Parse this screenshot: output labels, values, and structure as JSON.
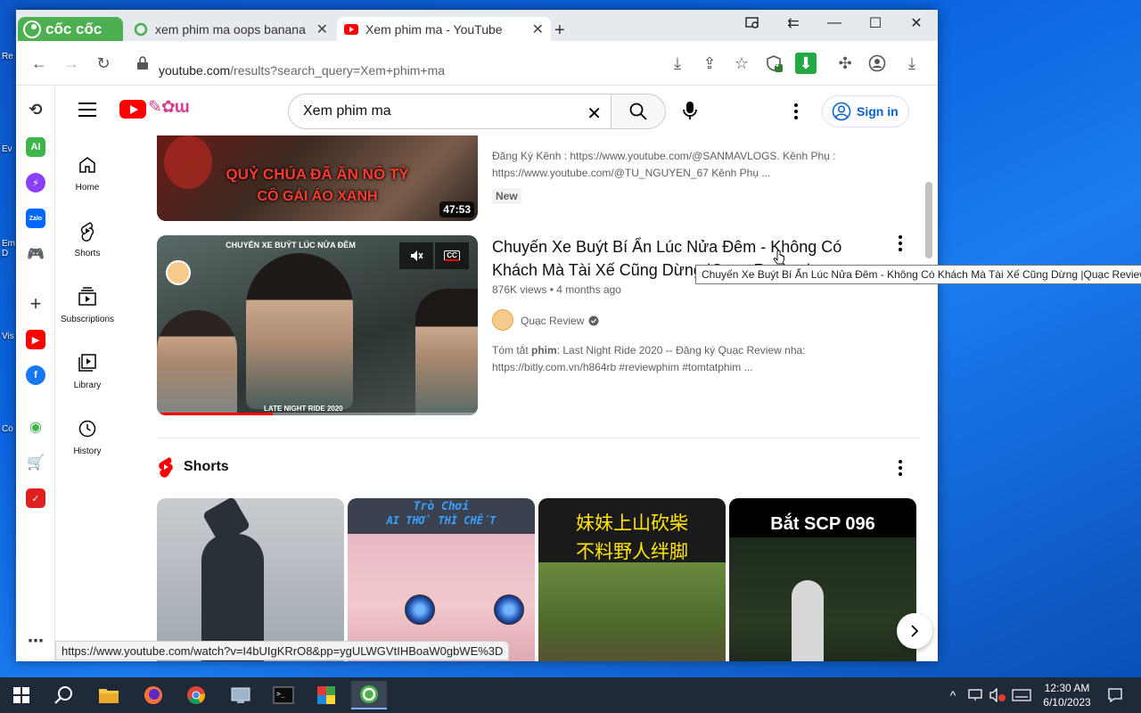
{
  "browser": {
    "brand": "cốc cốc",
    "tabs": [
      {
        "title": "xem phim ma oops banana -",
        "active": false
      },
      {
        "title": "Xem phim ma - YouTube",
        "active": true
      }
    ],
    "url_host": "youtube.com",
    "url_path": "/results?search_query=Xem+phim+ma",
    "status_url": "https://www.youtube.com/watch?v=I4bUIgKRrO8&pp=ygULWGVtIHBoaW0gbWE%3D",
    "badge_count": "4",
    "sidebar_labels": {
      "ai": "AI",
      "zalo": "Zalo"
    }
  },
  "youtube": {
    "search_query": "Xem phim ma",
    "sign_in": "Sign in",
    "sidebar": [
      {
        "label": "Home"
      },
      {
        "label": "Shorts"
      },
      {
        "label": "Subscriptions"
      },
      {
        "label": "Library"
      },
      {
        "label": "History"
      }
    ],
    "video1": {
      "thumb_caption_1": "QUỶ CHÚA ĐÃ ĂN NÔ TỲ",
      "thumb_caption_2": "CÔ GÁI ÁO XANH",
      "duration": "47:53",
      "desc_1": "Đăng Ký Kênh : https://www.youtube.com/@SANMAVLOGS. Kênh Phụ :",
      "desc_2": "https://www.youtube.com/@TU_NGUYEN_67 Kênh Phụ ...",
      "badge": "New"
    },
    "video2": {
      "thumb_top": "CHUYẾN XE BUÝT LÚC NỬA ĐÊM",
      "thumb_bottom": "LATE NIGHT RIDE 2020",
      "cc": "CC",
      "title_1": "Chuyến Xe Buýt Bí Ẩn Lúc Nửa Đêm - Không Có",
      "title_2": "Khách Mà Tài Xế Cũng Dừng |Quạc Review|",
      "views": "876K views",
      "age": "4 months ago",
      "channel": "Quạc Review",
      "desc_prefix": "Tóm tắt ",
      "desc_bold": "phim",
      "desc_1_rest": ": Last Night Ride 2020 -- Đăng ký Quạc Review nha:",
      "desc_2": "https://bitly.com.vn/h864rb #reviewphim #tomtatphim ..."
    },
    "tooltip": "Chuyến Xe Buýt Bí Ẩn Lúc Nửa Đêm - Không Có Khách Mà Tài Xế Cũng Dừng |Quạc Review|",
    "shorts_heading": "Shorts",
    "shorts": [
      {
        "caption": ""
      },
      {
        "caption_1": "Trò Chơi",
        "caption_2": "AI THỞ THÌ CHẾT"
      },
      {
        "caption_1": "妹妹上山砍柴",
        "caption_2": "不料野人绊脚"
      },
      {
        "caption_1": "Bắt SCP 096"
      }
    ]
  },
  "taskbar": {
    "time": "12:30 AM",
    "date": "6/10/2023"
  }
}
